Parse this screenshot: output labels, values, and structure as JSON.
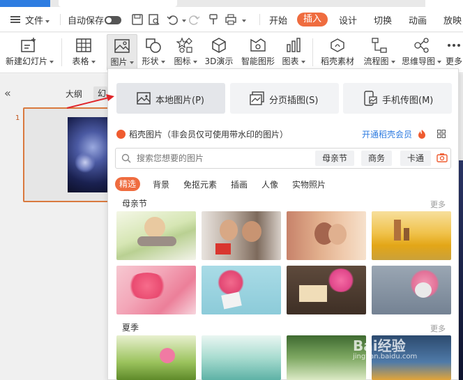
{
  "menubar": {
    "file": "文件",
    "autosave": "自动保存",
    "tabs": [
      "开始",
      "插入",
      "设计",
      "切换",
      "动画",
      "放映"
    ],
    "active_tab": "插入"
  },
  "ribbon": {
    "items": [
      "新建幻灯片",
      "表格",
      "图片",
      "形状",
      "图标",
      "3D演示",
      "智能图形",
      "图表",
      "稻壳素材",
      "流程图",
      "思维导图",
      "更多"
    ]
  },
  "left_panel": {
    "outline_tab": "大纲",
    "slide_tab": "幻",
    "slide_number": "1"
  },
  "picture_panel": {
    "sources": [
      "本地图片(P)",
      "分页插图(S)",
      "手机传图(M)"
    ],
    "daoke_title": "稻壳图片（非会员仅可使用带水印的图片）",
    "open_vip": "开通稻壳会员",
    "search_placeholder": "搜索您想要的图片",
    "search_chips": [
      "母亲节",
      "商务",
      "卡通"
    ],
    "categories": [
      "精选",
      "背景",
      "免抠元素",
      "插画",
      "人像",
      "实物照片"
    ],
    "active_category": "精选",
    "sections": [
      {
        "title": "母亲节",
        "more": "更多"
      },
      {
        "title": "夏季",
        "more": "更多"
      }
    ]
  },
  "watermark": {
    "text": "Bai经验",
    "url": "jingyan.baidu.com"
  },
  "colors": {
    "accent": "#ef6c3f",
    "link": "#2d7be0",
    "arrow": "#e0262b"
  }
}
